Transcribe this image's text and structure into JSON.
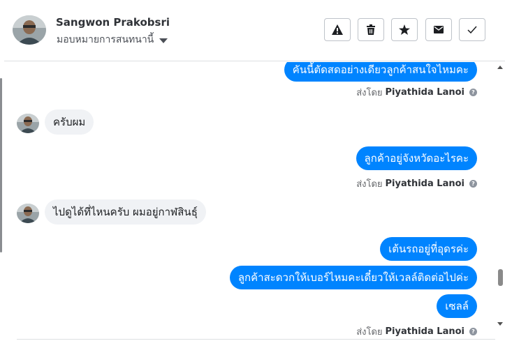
{
  "header": {
    "contact_name": "Sangwon Prakobsri",
    "assign_label": "มอบหมายการสนทนานี้",
    "actions": [
      {
        "icon": "warning-icon"
      },
      {
        "icon": "trash-icon"
      },
      {
        "icon": "star-icon"
      },
      {
        "icon": "mail-icon"
      },
      {
        "icon": "check-icon"
      }
    ]
  },
  "messages": [
    {
      "direction": "out",
      "text": "คันนี้ตัดสดอย่างเดียวลูกค้าสนใจไหมคะ"
    },
    {
      "direction": "in",
      "text": "ครับผม"
    },
    {
      "direction": "out",
      "text": "ลูกค้าอยู่จังหวัดอะไรคะ"
    },
    {
      "direction": "in",
      "text": "ไปดูได้ที่ไหนครับ ผมอยู่กาฬสินธุ์"
    },
    {
      "direction": "out",
      "text": "เต้นรถอยู่ที่อุดรค่ะ"
    },
    {
      "direction": "out",
      "text": "ลูกค้าสะดวกให้เบอร์ไหมคะเดี๋ยวให้เวลล์ติดต่อไปค่ะ"
    },
    {
      "direction": "out",
      "text": "เซลล์"
    }
  ],
  "sent_by": {
    "prefix": "ส่งโดย",
    "agent_name": "Piyathida Lanoi",
    "info_glyph": "?"
  },
  "colors": {
    "outgoing_bubble": "#0084ff",
    "incoming_bubble": "#f0f2f5",
    "header_text": "#303338"
  }
}
